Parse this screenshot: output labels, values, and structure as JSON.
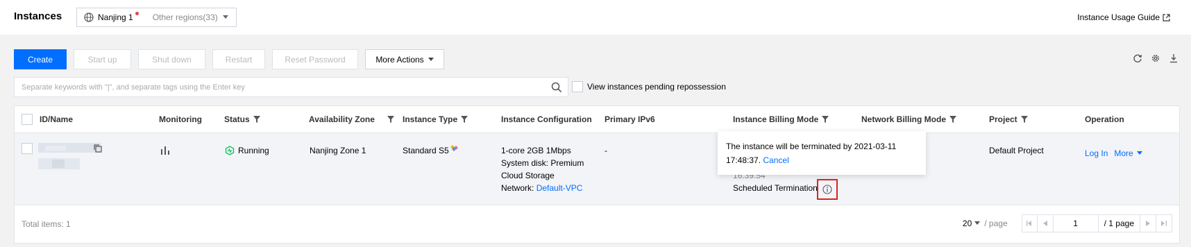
{
  "header": {
    "title": "Instances",
    "region_current": "Nanjing 1",
    "region_other": "Other regions(33)",
    "guide_link": "Instance Usage Guide"
  },
  "toolbar": {
    "create": "Create",
    "start_up": "Start up",
    "shut_down": "Shut down",
    "restart": "Restart",
    "reset_password": "Reset Password",
    "more_actions": "More Actions"
  },
  "search": {
    "placeholder": "Separate keywords with \"|\", and separate tags using the Enter key",
    "pending_label": "View instances pending repossession"
  },
  "table": {
    "columns": [
      "ID/Name",
      "Monitoring",
      "Status",
      "Availability Zone",
      "Instance Type",
      "Instance Configuration",
      "Primary IPv6",
      "Instance Billing Mode",
      "Network Billing Mode",
      "Project",
      "Operation"
    ],
    "row": {
      "status": "Running",
      "zone": "Nanjing Zone 1",
      "type": "Standard S5",
      "config_line1": "1-core 2GB 1Mbps",
      "config_line2": "System disk: Premium",
      "config_line3": "Cloud Storage",
      "config_network_label": "Network:",
      "config_network_link": "Default-VPC",
      "ipv6": "-",
      "billing_partial": "16:39:54",
      "billing_scheduled": "Scheduled Termination",
      "project": "Default Project",
      "op_login": "Log In",
      "op_more": "More"
    }
  },
  "tooltip": {
    "text": "The instance will be terminated by 2021-03-11 17:48:37.",
    "cancel": "Cancel"
  },
  "footer": {
    "total": "Total items: 1",
    "page_size": "20",
    "per_page": "/ page",
    "page_value": "1",
    "page_total": "/ 1 page"
  },
  "colors": {
    "primary": "#006eff",
    "running": "#0abf5b",
    "highlight": "#e02020"
  }
}
